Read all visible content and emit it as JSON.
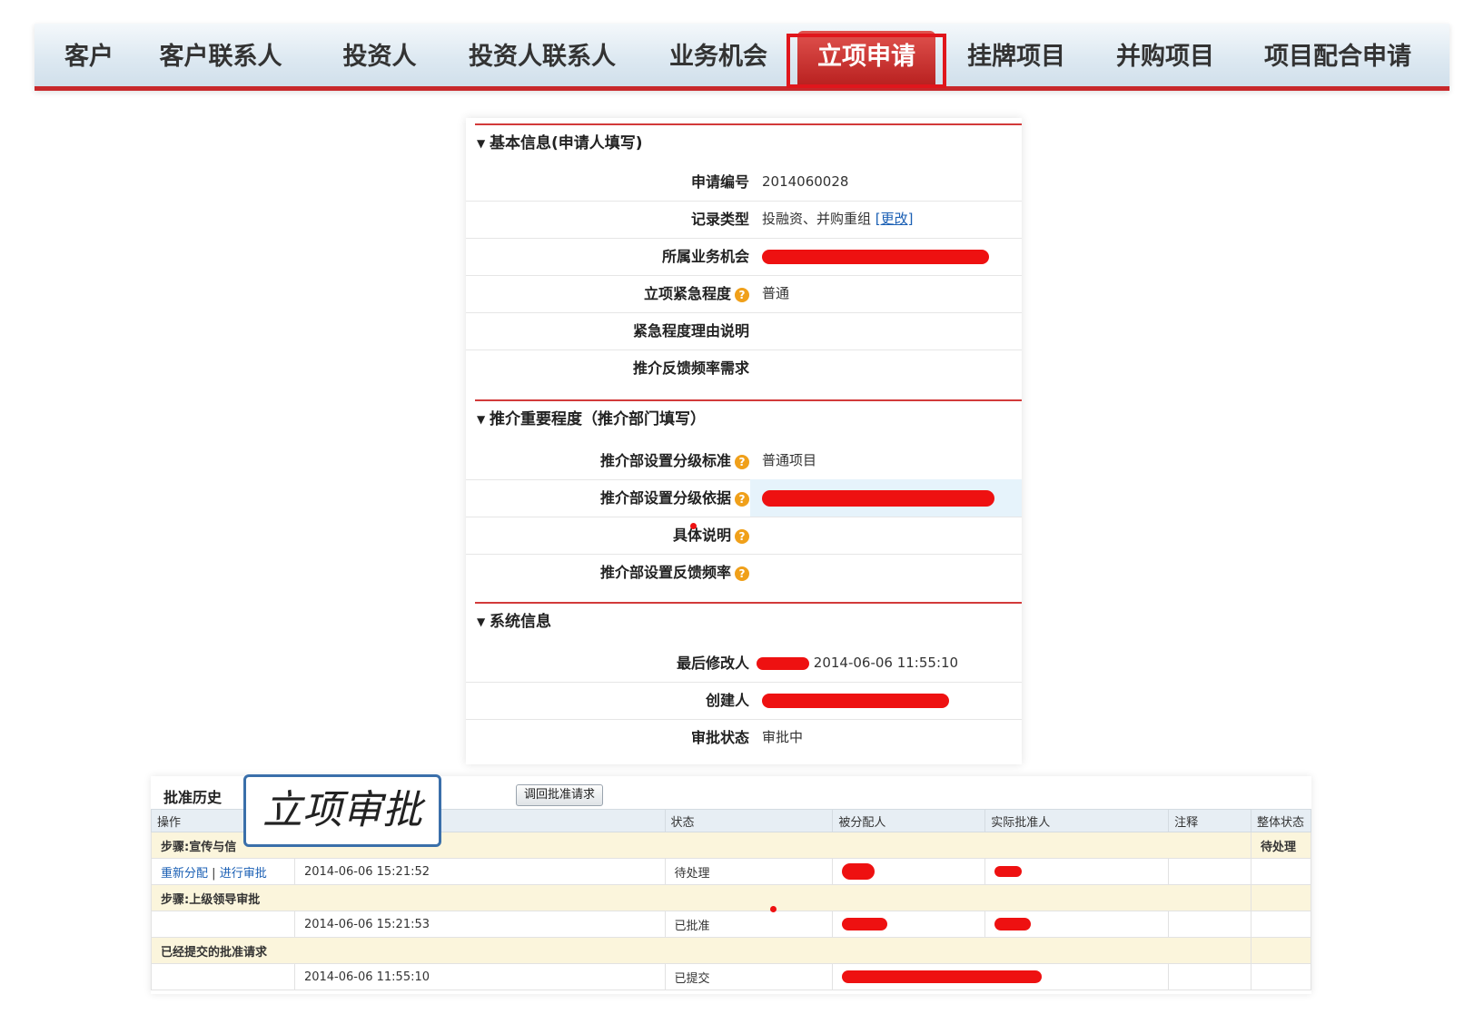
{
  "nav": {
    "tabs": [
      {
        "label": "客户"
      },
      {
        "label": "客户联系人"
      },
      {
        "label": "投资人"
      },
      {
        "label": "投资人联系人"
      },
      {
        "label": "业务机会"
      },
      {
        "label": "立项申请",
        "active": true
      },
      {
        "label": "挂牌项目"
      },
      {
        "label": "并购项目"
      },
      {
        "label": "项目配合申请"
      }
    ]
  },
  "sections": {
    "basic": {
      "title": "基本信息(申请人填写)",
      "rows": [
        {
          "label": "申请编号",
          "value": "2014060028"
        },
        {
          "label": "记录类型",
          "value": "投融资、并购重组",
          "link": "[更改]"
        },
        {
          "label": "所属业务机会",
          "value": "[redacted]"
        },
        {
          "label": "立项紧急程度",
          "value": "普通"
        },
        {
          "label": "紧急程度理由说明",
          "value": ""
        },
        {
          "label": "推介反馈频率需求",
          "value": ""
        }
      ]
    },
    "importance": {
      "title": "推介重要程度（推介部门填写）",
      "rows": [
        {
          "label": "推介部设置分级标准",
          "value": "普通项目"
        },
        {
          "label": "推介部设置分级依据",
          "value": "[redacted]"
        },
        {
          "label": "具体说明",
          "value": ""
        },
        {
          "label": "推介部设置反馈频率",
          "value": ""
        }
      ]
    },
    "system": {
      "title": "系统信息",
      "rows": [
        {
          "label": "最后修改人",
          "value": "2014-06-06 11:55:10"
        },
        {
          "label": "创建人",
          "value": "[redacted]"
        },
        {
          "label": "审批状态",
          "value": "审批中"
        }
      ]
    }
  },
  "history": {
    "title": "批准历史",
    "recall_button": "调回批准请求",
    "columns": [
      "操作",
      "",
      "状态",
      "被分配人",
      "实际批准人",
      "注释",
      "整体状态"
    ],
    "steps": [
      {
        "label": "步骤:宣传与信",
        "overall": "待处理",
        "rows": [
          {
            "actions": [
              "重新分配",
              "进行审批"
            ],
            "separator": "|",
            "time": "2014-06-06 15:21:52",
            "status": "待处理"
          }
        ]
      },
      {
        "label": "步骤:上级领导审批",
        "overall": "",
        "rows": [
          {
            "actions": [],
            "time": "2014-06-06 15:21:53",
            "status": "已批准"
          }
        ]
      },
      {
        "label": "已经提交的批准请求",
        "overall": "",
        "rows": [
          {
            "actions": [],
            "time": "2014-06-06 11:55:10",
            "status": "已提交"
          }
        ]
      }
    ]
  },
  "callout": {
    "text": "立项审批"
  },
  "colors": {
    "accent": "#c8282b",
    "highlight_box": "#e0161c",
    "redaction": "#ee1111",
    "callout_border": "#3a6faa"
  }
}
